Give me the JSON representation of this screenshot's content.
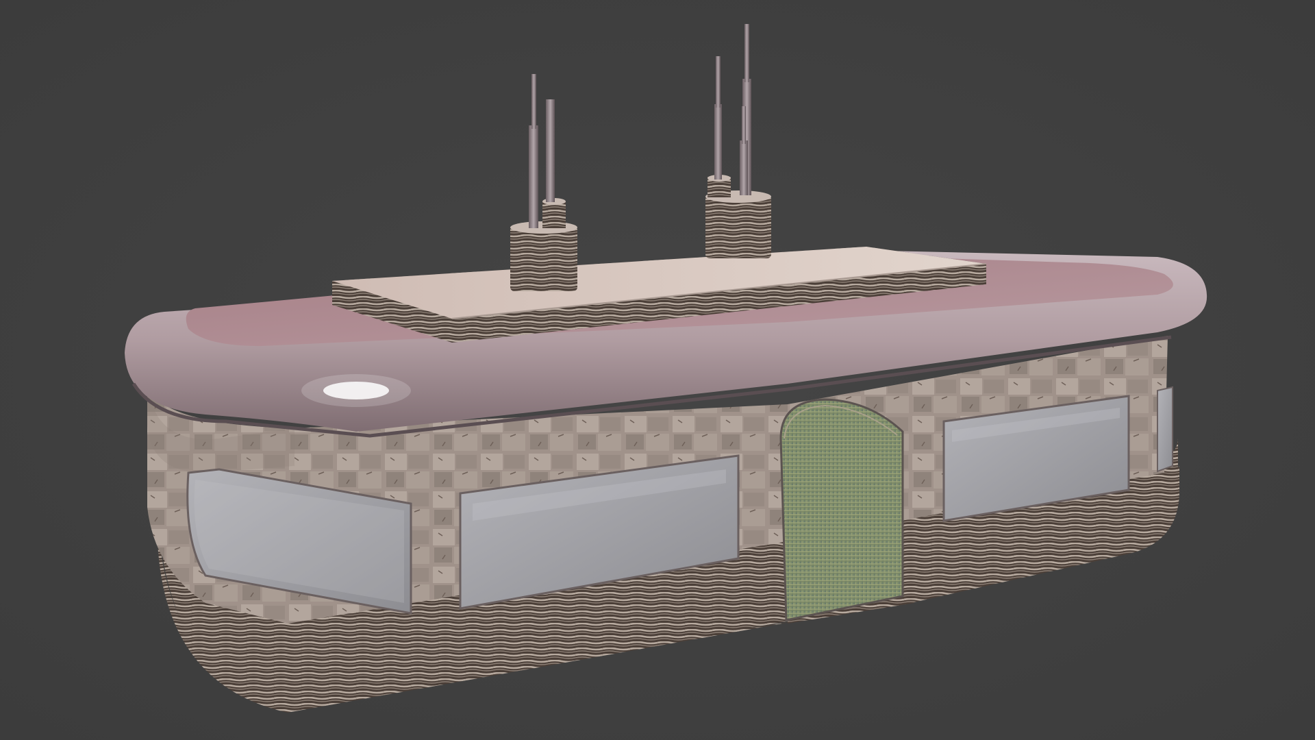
{
  "viewport": {
    "background": "#404040"
  },
  "model": {
    "subject": "diner-building",
    "palette": {
      "roof": "#b8a3a8",
      "roof_top": "#a4858a",
      "cap": "#d8c7bf",
      "stone": "#a8998f",
      "stone_dark": "#4a3d36",
      "window": "#a2a2a6",
      "door": "#7c8a70",
      "pole": "#8f8287"
    }
  }
}
